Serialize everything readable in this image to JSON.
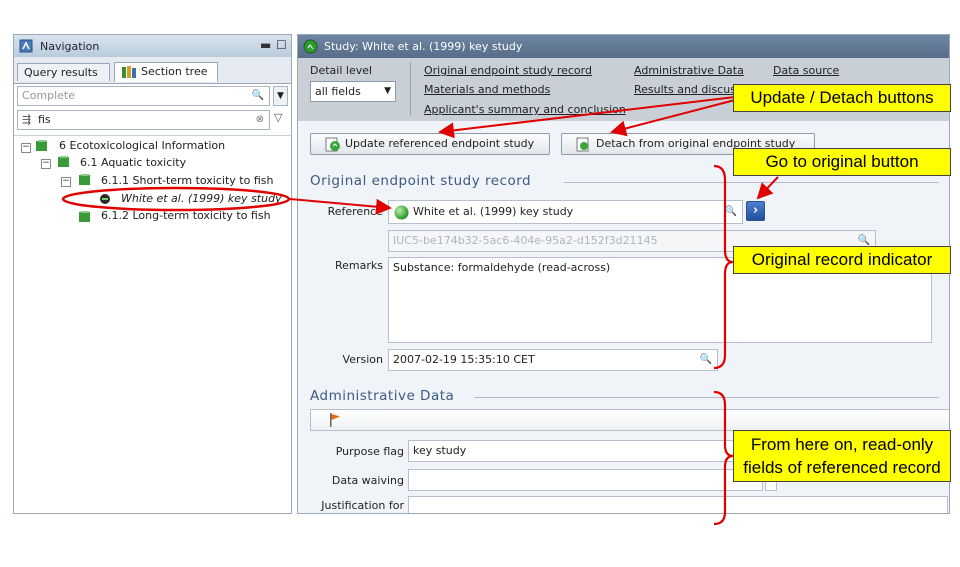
{
  "navigation": {
    "title": "Navigation",
    "tabs": [
      "Query results",
      "Section tree"
    ],
    "filter_placeholder": "Complete",
    "search_value": "fis",
    "tree": [
      {
        "label": "6 Ecotoxicological Information"
      },
      {
        "label": "6.1 Aquatic toxicity"
      },
      {
        "label": "6.1.1 Short-term toxicity to fish"
      },
      {
        "label": "White et al. (1999) key study"
      },
      {
        "label": "6.1.2 Long-term toxicity to fish"
      }
    ]
  },
  "study": {
    "title": "Study: White et al. (1999) key study",
    "detail_level_label": "Detail level",
    "detail_level_value": "all fields",
    "links": {
      "original": "Original endpoint study record",
      "admin": "Administrative Data",
      "source": "Data source",
      "materials": "Materials and methods",
      "results": "Results and discussion",
      "applicant": "Applicant's summary and conclusion"
    },
    "buttons": {
      "update": "Update referenced endpoint study",
      "detach": "Detach from original endpoint study"
    },
    "original_section_title": "Original endpoint study record",
    "reference_label": "Reference",
    "reference_value": "White et al. (1999) key study",
    "uuid_value": "IUC5-be174b32-5ac6-404e-95a2-d152f3d21145",
    "remarks_label": "Remarks",
    "remarks_value": "Substance: formaldehyde (read-across)",
    "version_label": "Version",
    "version_value": "2007-02-19 15:35:10 CET",
    "admin_section_title": "Administrative Data",
    "purpose_flag_label": "Purpose flag",
    "purpose_flag_value": "key study",
    "data_waiving_label": "Data waiving",
    "justification_label": "Justification for"
  },
  "callouts": {
    "update_detach": "Update / Detach buttons",
    "go_to_original": "Go to original button",
    "indicator": "Original record indicator",
    "readonly_line1": "From here on, read-only",
    "readonly_line2": "fields of referenced record"
  },
  "colors": {
    "callout": "#ffff00",
    "arrow": "#e00000",
    "accent": "#3c5a82"
  }
}
